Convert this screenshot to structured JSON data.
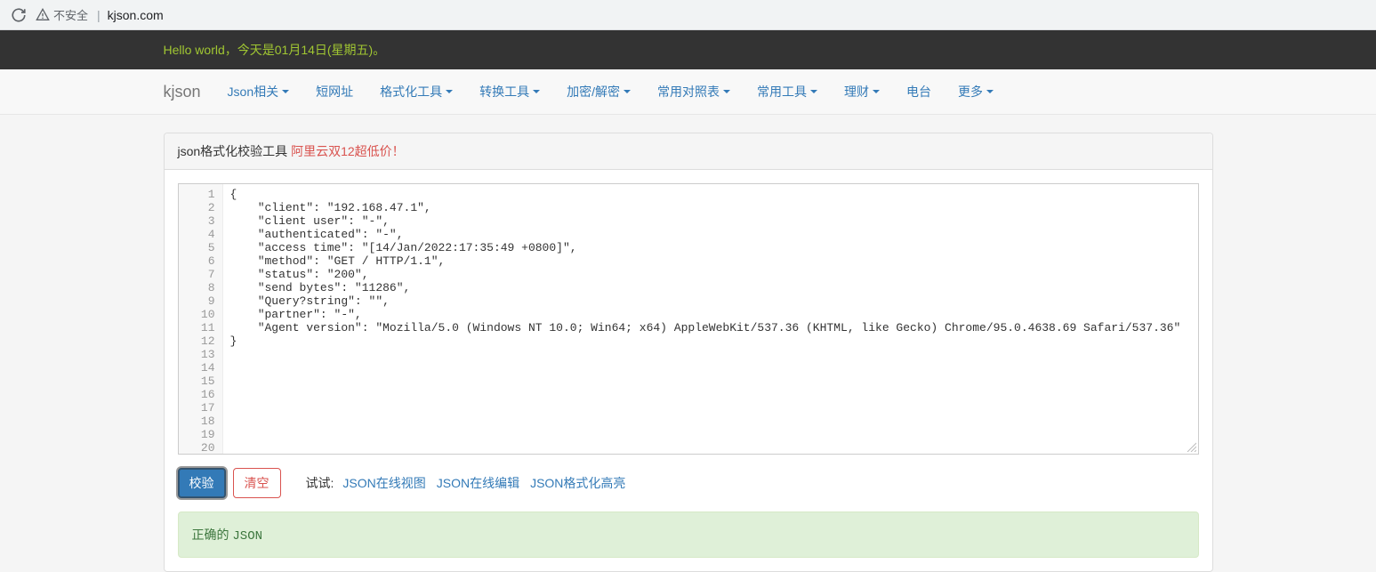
{
  "browser": {
    "security_label": "不安全",
    "url": "kjson.com"
  },
  "banner": {
    "text": "Hello world，今天是01月14日(星期五)。"
  },
  "nav": {
    "brand": "kjson",
    "items": [
      {
        "label": "Json相关",
        "dropdown": true
      },
      {
        "label": "短网址",
        "dropdown": false
      },
      {
        "label": "格式化工具",
        "dropdown": true
      },
      {
        "label": "转换工具",
        "dropdown": true
      },
      {
        "label": "加密/解密",
        "dropdown": true
      },
      {
        "label": "常用对照表",
        "dropdown": true
      },
      {
        "label": "常用工具",
        "dropdown": true
      },
      {
        "label": "理财",
        "dropdown": true
      },
      {
        "label": "电台",
        "dropdown": false
      },
      {
        "label": "更多",
        "dropdown": true
      }
    ]
  },
  "panel": {
    "title": "json格式化校验工具",
    "promo": "阿里云双12超低价！"
  },
  "editor": {
    "total_lines": 20,
    "lines": [
      "{",
      "    \"client\": \"192.168.47.1\",",
      "    \"client user\": \"-\",",
      "    \"authenticated\": \"-\",",
      "    \"access time\": \"[14/Jan/2022:17:35:49 +0800]\",",
      "    \"method\": \"GET / HTTP/1.1\",",
      "    \"status\": \"200\",",
      "    \"send bytes\": \"11286\",",
      "    \"Query?string\": \"\",",
      "    \"partner\": \"-\",",
      "    \"Agent version\": \"Mozilla/5.0 (Windows NT 10.0; Win64; x64) AppleWebKit/537.36 (KHTML, like Gecko) Chrome/95.0.4638.69 Safari/537.36\"",
      "}"
    ]
  },
  "actions": {
    "validate": "校验",
    "clear": "清空",
    "try_label": "试试:",
    "try_links": [
      "JSON在线视图",
      "JSON在线编辑",
      "JSON格式化高亮"
    ]
  },
  "result": {
    "prefix": "正确的 ",
    "code": "JSON"
  }
}
